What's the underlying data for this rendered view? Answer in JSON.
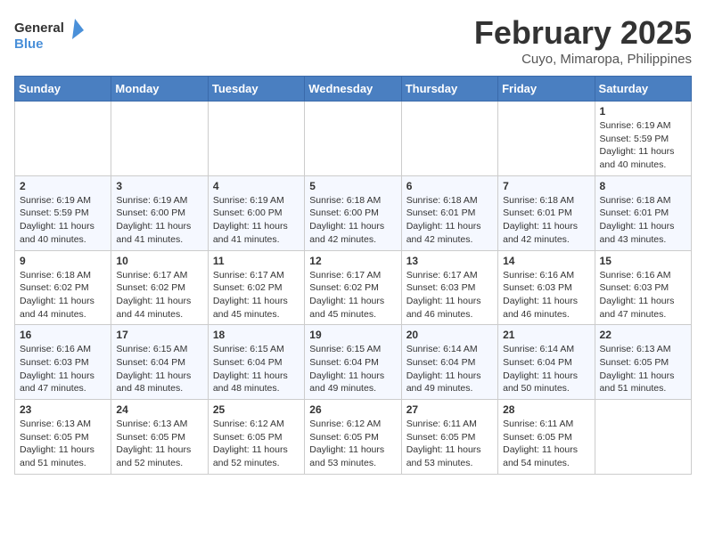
{
  "header": {
    "logo_general": "General",
    "logo_blue": "Blue",
    "month": "February 2025",
    "location": "Cuyo, Mimaropa, Philippines"
  },
  "weekdays": [
    "Sunday",
    "Monday",
    "Tuesday",
    "Wednesday",
    "Thursday",
    "Friday",
    "Saturday"
  ],
  "weeks": [
    [
      {
        "day": "",
        "info": ""
      },
      {
        "day": "",
        "info": ""
      },
      {
        "day": "",
        "info": ""
      },
      {
        "day": "",
        "info": ""
      },
      {
        "day": "",
        "info": ""
      },
      {
        "day": "",
        "info": ""
      },
      {
        "day": "1",
        "info": "Sunrise: 6:19 AM\nSunset: 5:59 PM\nDaylight: 11 hours\nand 40 minutes."
      }
    ],
    [
      {
        "day": "2",
        "info": "Sunrise: 6:19 AM\nSunset: 5:59 PM\nDaylight: 11 hours\nand 40 minutes."
      },
      {
        "day": "3",
        "info": "Sunrise: 6:19 AM\nSunset: 6:00 PM\nDaylight: 11 hours\nand 41 minutes."
      },
      {
        "day": "4",
        "info": "Sunrise: 6:19 AM\nSunset: 6:00 PM\nDaylight: 11 hours\nand 41 minutes."
      },
      {
        "day": "5",
        "info": "Sunrise: 6:18 AM\nSunset: 6:00 PM\nDaylight: 11 hours\nand 42 minutes."
      },
      {
        "day": "6",
        "info": "Sunrise: 6:18 AM\nSunset: 6:01 PM\nDaylight: 11 hours\nand 42 minutes."
      },
      {
        "day": "7",
        "info": "Sunrise: 6:18 AM\nSunset: 6:01 PM\nDaylight: 11 hours\nand 42 minutes."
      },
      {
        "day": "8",
        "info": "Sunrise: 6:18 AM\nSunset: 6:01 PM\nDaylight: 11 hours\nand 43 minutes."
      }
    ],
    [
      {
        "day": "9",
        "info": "Sunrise: 6:18 AM\nSunset: 6:02 PM\nDaylight: 11 hours\nand 44 minutes."
      },
      {
        "day": "10",
        "info": "Sunrise: 6:17 AM\nSunset: 6:02 PM\nDaylight: 11 hours\nand 44 minutes."
      },
      {
        "day": "11",
        "info": "Sunrise: 6:17 AM\nSunset: 6:02 PM\nDaylight: 11 hours\nand 45 minutes."
      },
      {
        "day": "12",
        "info": "Sunrise: 6:17 AM\nSunset: 6:02 PM\nDaylight: 11 hours\nand 45 minutes."
      },
      {
        "day": "13",
        "info": "Sunrise: 6:17 AM\nSunset: 6:03 PM\nDaylight: 11 hours\nand 46 minutes."
      },
      {
        "day": "14",
        "info": "Sunrise: 6:16 AM\nSunset: 6:03 PM\nDaylight: 11 hours\nand 46 minutes."
      },
      {
        "day": "15",
        "info": "Sunrise: 6:16 AM\nSunset: 6:03 PM\nDaylight: 11 hours\nand 47 minutes."
      }
    ],
    [
      {
        "day": "16",
        "info": "Sunrise: 6:16 AM\nSunset: 6:03 PM\nDaylight: 11 hours\nand 47 minutes."
      },
      {
        "day": "17",
        "info": "Sunrise: 6:15 AM\nSunset: 6:04 PM\nDaylight: 11 hours\nand 48 minutes."
      },
      {
        "day": "18",
        "info": "Sunrise: 6:15 AM\nSunset: 6:04 PM\nDaylight: 11 hours\nand 48 minutes."
      },
      {
        "day": "19",
        "info": "Sunrise: 6:15 AM\nSunset: 6:04 PM\nDaylight: 11 hours\nand 49 minutes."
      },
      {
        "day": "20",
        "info": "Sunrise: 6:14 AM\nSunset: 6:04 PM\nDaylight: 11 hours\nand 49 minutes."
      },
      {
        "day": "21",
        "info": "Sunrise: 6:14 AM\nSunset: 6:04 PM\nDaylight: 11 hours\nand 50 minutes."
      },
      {
        "day": "22",
        "info": "Sunrise: 6:13 AM\nSunset: 6:05 PM\nDaylight: 11 hours\nand 51 minutes."
      }
    ],
    [
      {
        "day": "23",
        "info": "Sunrise: 6:13 AM\nSunset: 6:05 PM\nDaylight: 11 hours\nand 51 minutes."
      },
      {
        "day": "24",
        "info": "Sunrise: 6:13 AM\nSunset: 6:05 PM\nDaylight: 11 hours\nand 52 minutes."
      },
      {
        "day": "25",
        "info": "Sunrise: 6:12 AM\nSunset: 6:05 PM\nDaylight: 11 hours\nand 52 minutes."
      },
      {
        "day": "26",
        "info": "Sunrise: 6:12 AM\nSunset: 6:05 PM\nDaylight: 11 hours\nand 53 minutes."
      },
      {
        "day": "27",
        "info": "Sunrise: 6:11 AM\nSunset: 6:05 PM\nDaylight: 11 hours\nand 53 minutes."
      },
      {
        "day": "28",
        "info": "Sunrise: 6:11 AM\nSunset: 6:05 PM\nDaylight: 11 hours\nand 54 minutes."
      },
      {
        "day": "",
        "info": ""
      }
    ]
  ]
}
